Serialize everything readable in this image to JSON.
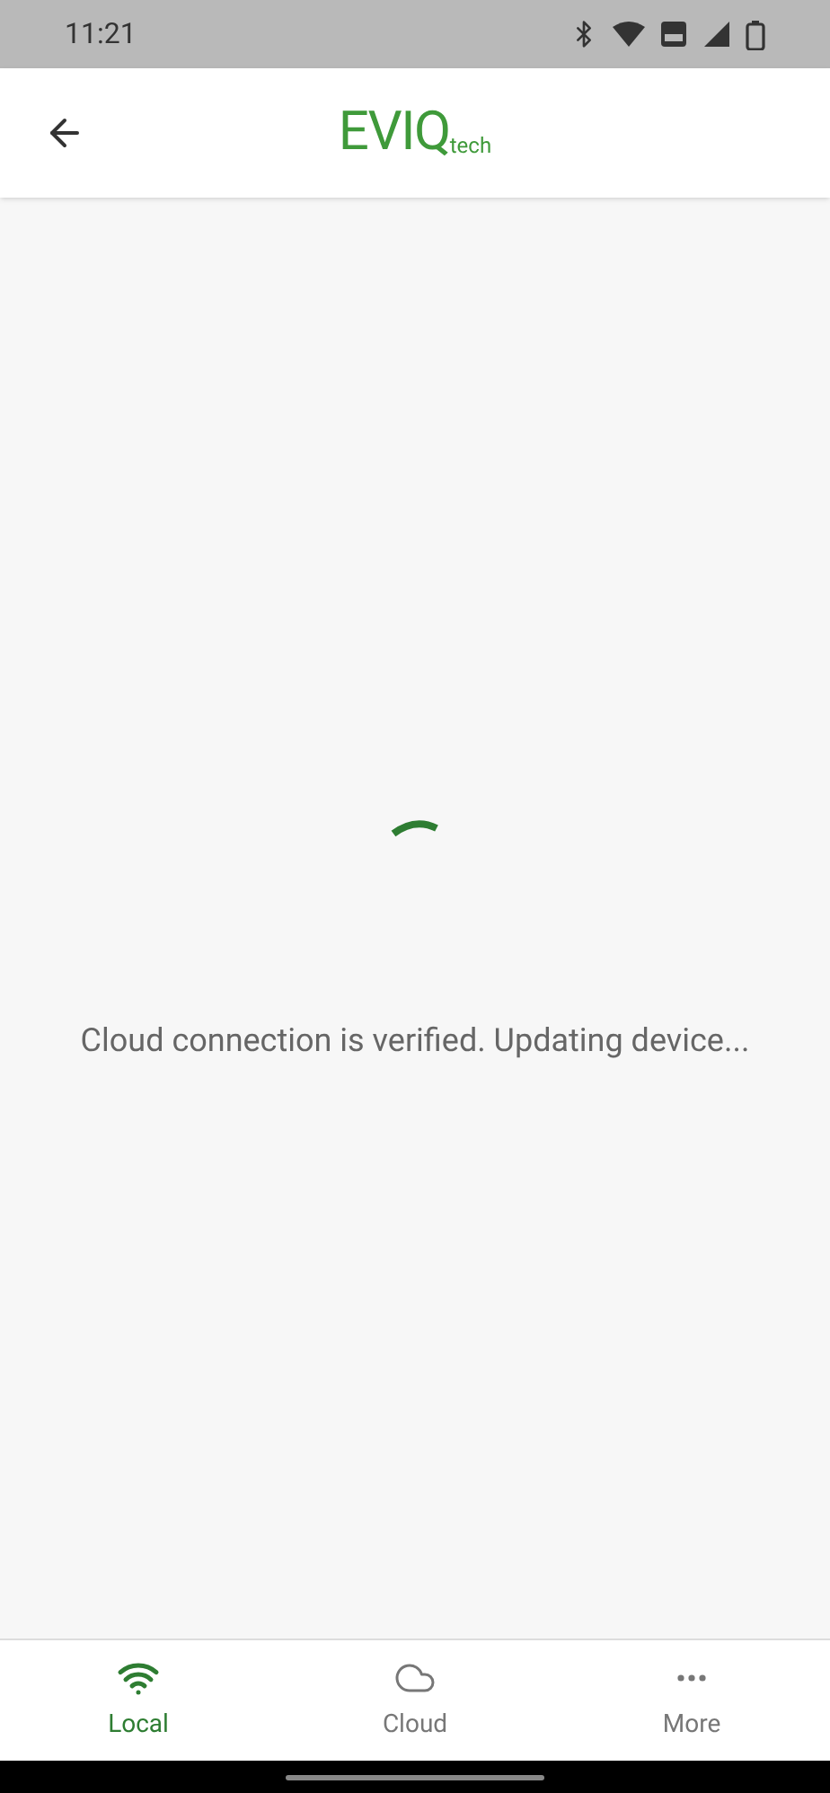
{
  "status_bar": {
    "time": "11:21"
  },
  "header": {
    "logo": {
      "main": "EVIQ",
      "sub": "tech"
    }
  },
  "content": {
    "message": "Cloud connection is verified. Updating device..."
  },
  "tabs": [
    {
      "kind": "wifi",
      "label": "Local",
      "selected": true
    },
    {
      "kind": "cloud",
      "label": "Cloud",
      "selected": false
    },
    {
      "kind": "more",
      "label": "More",
      "selected": false
    }
  ]
}
